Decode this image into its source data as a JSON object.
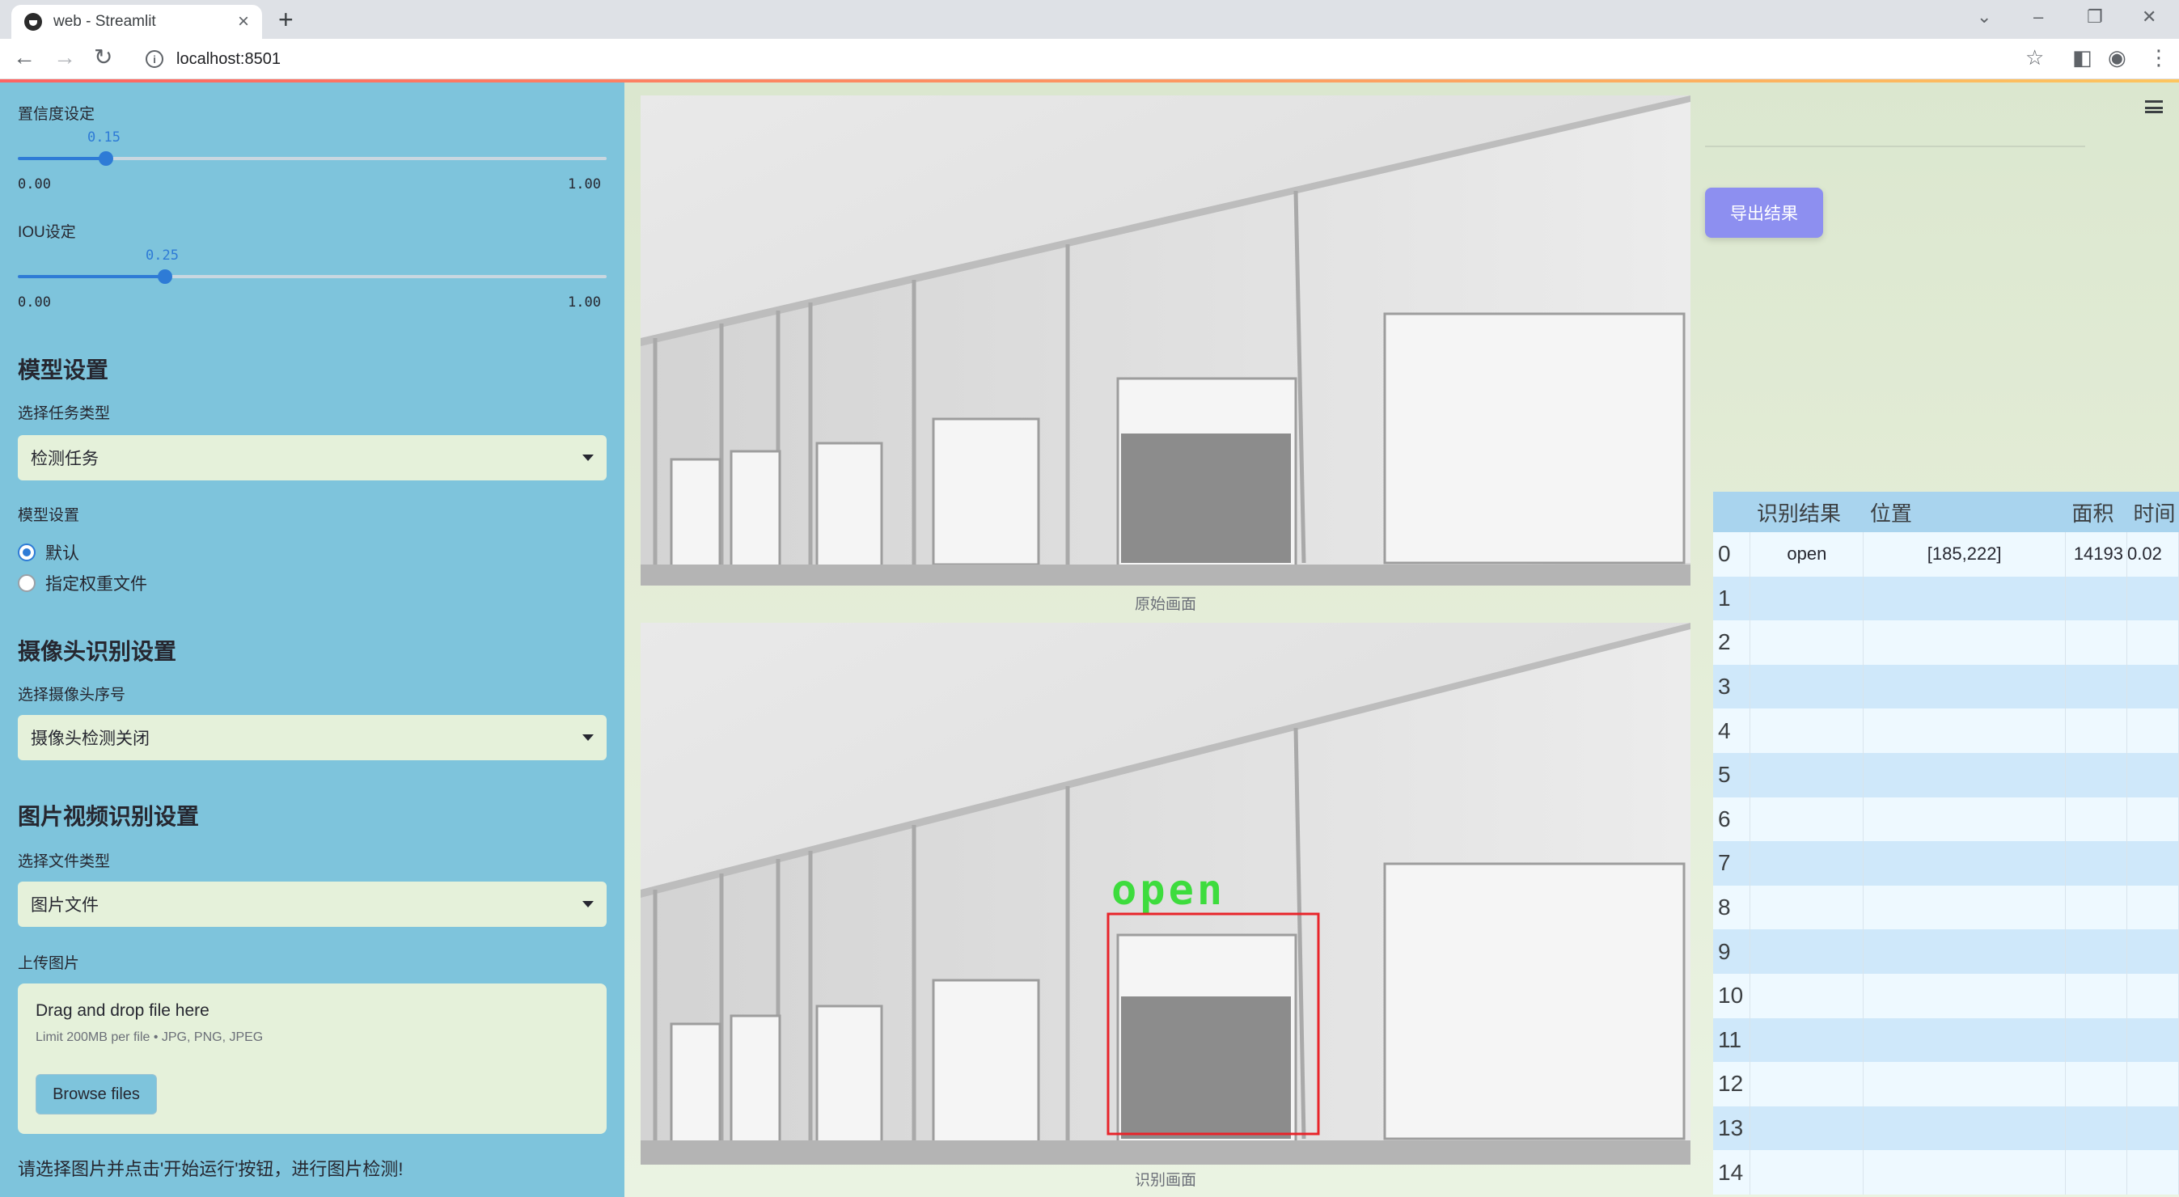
{
  "browser": {
    "tab_title": "web - Streamlit",
    "url": "localhost:8501"
  },
  "sidebar": {
    "confidence_label": "置信度设定",
    "confidence_value": "0.15",
    "confidence_fraction": 0.15,
    "confidence_min": "0.00",
    "confidence_max": "1.00",
    "iou_label": "IOU设定",
    "iou_value": "0.25",
    "iou_fraction": 0.25,
    "iou_min": "0.00",
    "iou_max": "1.00",
    "model_heading": "模型设置",
    "task_type_label": "选择任务类型",
    "task_type_value": "检测任务",
    "model_settings_label": "模型设置",
    "radio_default": "默认",
    "radio_custom": "指定权重文件",
    "camera_heading": "摄像头识别设置",
    "camera_index_label": "选择摄像头序号",
    "camera_index_value": "摄像头检测关闭",
    "media_heading": "图片视频识别设置",
    "file_type_label": "选择文件类型",
    "file_type_value": "图片文件",
    "upload_label": "上传图片",
    "upload_title": "Drag and drop file here",
    "upload_limit": "Limit 200MB per file • JPG, PNG, JPEG",
    "browse_label": "Browse files",
    "bottom_hint": "请选择图片并点击'开始运行'按钮，进行图片检测!"
  },
  "main": {
    "original_caption": "原始画面",
    "result_caption": "识别画面",
    "detection_label": "open",
    "export_label": "导出结果"
  },
  "table": {
    "headers": [
      "",
      "识别结果",
      "位置",
      "面积",
      "时间"
    ],
    "rows": [
      {
        "idx": "0",
        "result": "open",
        "position": "[185,222]",
        "area": "14193",
        "time": "0.02"
      },
      {
        "idx": "1",
        "result": "",
        "position": "",
        "area": "",
        "time": ""
      },
      {
        "idx": "2",
        "result": "",
        "position": "",
        "area": "",
        "time": ""
      },
      {
        "idx": "3",
        "result": "",
        "position": "",
        "area": "",
        "time": ""
      },
      {
        "idx": "4",
        "result": "",
        "position": "",
        "area": "",
        "time": ""
      },
      {
        "idx": "5",
        "result": "",
        "position": "",
        "area": "",
        "time": ""
      },
      {
        "idx": "6",
        "result": "",
        "position": "",
        "area": "",
        "time": ""
      },
      {
        "idx": "7",
        "result": "",
        "position": "",
        "area": "",
        "time": ""
      },
      {
        "idx": "8",
        "result": "",
        "position": "",
        "area": "",
        "time": ""
      },
      {
        "idx": "9",
        "result": "",
        "position": "",
        "area": "",
        "time": ""
      },
      {
        "idx": "10",
        "result": "",
        "position": "",
        "area": "",
        "time": ""
      },
      {
        "idx": "11",
        "result": "",
        "position": "",
        "area": "",
        "time": ""
      },
      {
        "idx": "12",
        "result": "",
        "position": "",
        "area": "",
        "time": ""
      },
      {
        "idx": "13",
        "result": "",
        "position": "",
        "area": "",
        "time": ""
      },
      {
        "idx": "14",
        "result": "",
        "position": "",
        "area": "",
        "time": ""
      }
    ]
  },
  "colors": {
    "sidebar_bg": "#7ec4dc",
    "accent": "#2e7bd6",
    "export_button": "#8d8ff0",
    "detection_box": "#e8242a",
    "detection_text": "#3ddc3d"
  }
}
